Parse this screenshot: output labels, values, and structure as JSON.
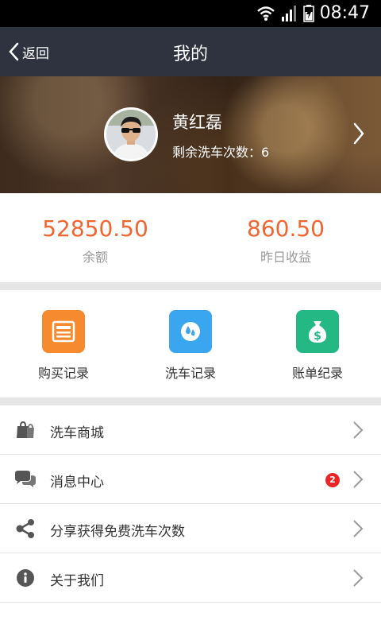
{
  "status_bar": {
    "time": "08:47"
  },
  "nav": {
    "back_label": "返回",
    "title": "我的"
  },
  "profile": {
    "name": "黄红磊",
    "wash_count": "剩余洗车次数：6"
  },
  "balances": [
    {
      "value": "52850.50",
      "label": "余额"
    },
    {
      "value": "860.50",
      "label": "昨日收益"
    }
  ],
  "shortcuts": [
    {
      "label": "购买记录",
      "color": "#f58a2e",
      "icon": "purchase-record-icon"
    },
    {
      "label": "洗车记录",
      "color": "#3aa6ef",
      "icon": "water-drop-icon"
    },
    {
      "label": "账单纪录",
      "color": "#24b884",
      "icon": "money-bag-icon"
    }
  ],
  "menu": [
    {
      "label": "洗车商城",
      "icon": "shopping-bag-icon"
    },
    {
      "label": "消息中心",
      "icon": "chat-bubbles-icon",
      "badge": "2"
    },
    {
      "label": "分享获得免费洗车次数",
      "icon": "share-icon"
    },
    {
      "label": "关于我们",
      "icon": "info-icon"
    }
  ],
  "colors": {
    "accent": "#f06530",
    "nav_bg": "#2f3340",
    "badge": "#e92525"
  }
}
